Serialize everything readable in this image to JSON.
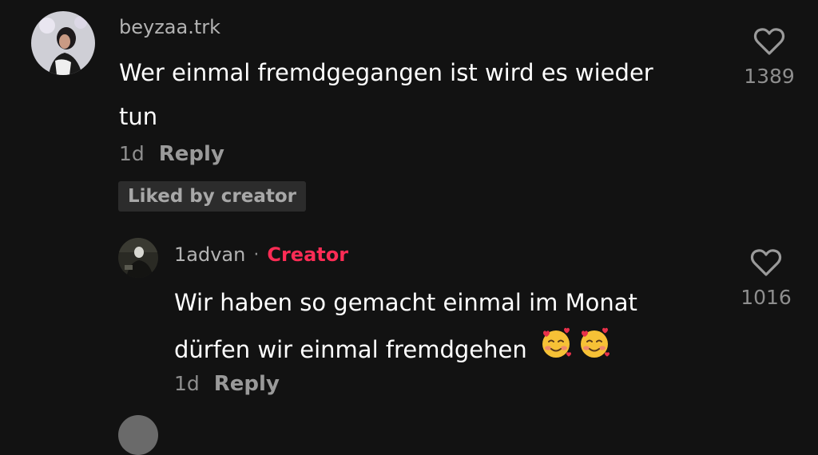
{
  "comments": [
    {
      "username": "beyzaa.trk",
      "text_lines": [
        "Wer einmal fremdgegangen ist wird es wieder",
        "tun"
      ],
      "time": "1d",
      "reply_label": "Reply",
      "liked_badge": "Liked by creator",
      "likes": "1389",
      "like_icon": "heart-outline-icon"
    }
  ],
  "reply": {
    "username": "1advan",
    "separator": "·",
    "creator_label": "Creator",
    "text_lines": [
      "Wir haben so gemacht einmal im Monat",
      "dürfen wir einmal fremdgehen"
    ],
    "emojis": [
      "smiling-face-with-hearts-icon",
      "smiling-face-with-hearts-icon"
    ],
    "time": "1d",
    "reply_label": "Reply",
    "likes": "1016",
    "like_icon": "heart-outline-icon"
  },
  "colors": {
    "background": "#121212",
    "creator_accent": "#fe2c55",
    "muted_text": "#8e8e8e"
  }
}
